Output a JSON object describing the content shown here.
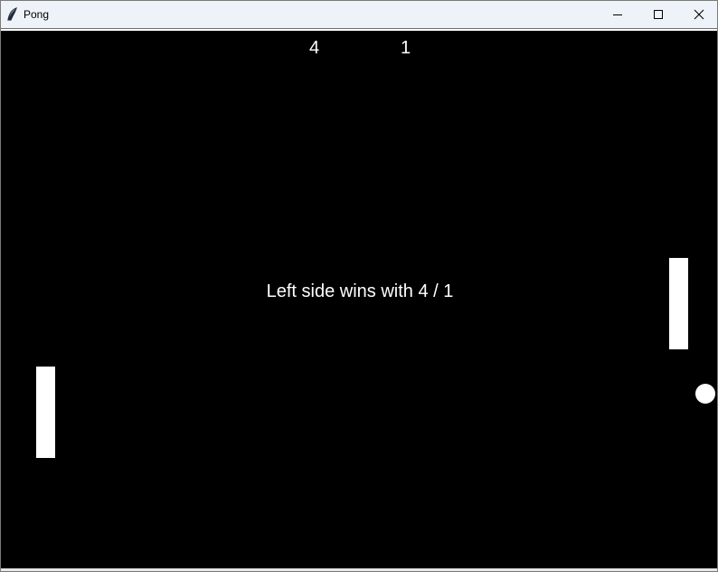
{
  "window": {
    "title": "Pong",
    "icons": {
      "app": "feather-icon",
      "minimize": "minimize-icon",
      "maximize": "maximize-icon",
      "close": "close-icon"
    }
  },
  "game": {
    "score_left": "4",
    "score_right": "1",
    "message": "Left side wins with 4 / 1",
    "colors": {
      "background": "#000000",
      "foreground": "#ffffff"
    }
  }
}
